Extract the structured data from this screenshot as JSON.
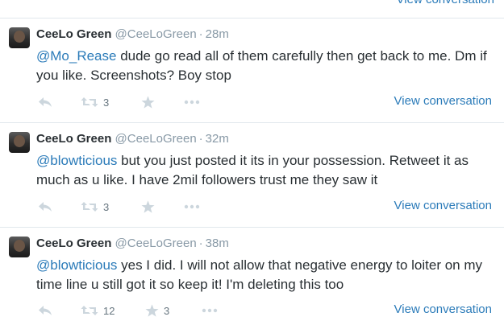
{
  "top": {
    "view_conversation": "View conversation"
  },
  "tweets": [
    {
      "name": "CeeLo Green",
      "handle": "@CeeLoGreen",
      "sep": "·",
      "time": "28m",
      "mention": "@Mo_Rease",
      "text": " dude go read all of them carefully then get back to me. Dm if you like. Screenshots? Boy stop",
      "retweets": "3",
      "favorites": "",
      "view_conversation": "View conversation"
    },
    {
      "name": "CeeLo Green",
      "handle": "@CeeLoGreen",
      "sep": "·",
      "time": "32m",
      "mention": "@blowticious",
      "text": " but you just posted it its in your possession. Retweet it as much as u like. I have 2mil followers trust me they saw it",
      "retweets": "3",
      "favorites": "",
      "view_conversation": "View conversation"
    },
    {
      "name": "CeeLo Green",
      "handle": "@CeeLoGreen",
      "sep": "·",
      "time": "38m",
      "mention": "@blowticious",
      "text": " yes I did. I will not allow that negative energy to loiter on my time line u still got it so keep it! I'm deleting this too",
      "retweets": "12",
      "favorites": "3",
      "view_conversation": "View conversation"
    }
  ],
  "icons": {
    "reply": "reply-icon",
    "retweet": "retweet-icon",
    "favorite": "star-icon",
    "more": "more-icon"
  },
  "colors": {
    "link": "#2b7bb9",
    "muted": "#8899a6",
    "text": "#292f33",
    "divider": "#e1e8ed"
  }
}
